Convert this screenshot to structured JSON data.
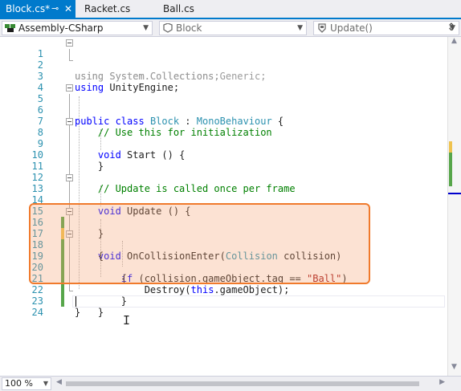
{
  "tabs": [
    {
      "label": "Block.cs*",
      "active": true,
      "pin_icon": "pin-icon",
      "close_icon": "close-icon"
    },
    {
      "label": "Racket.cs",
      "active": false
    },
    {
      "label": "Ball.cs",
      "active": false
    }
  ],
  "navbar": {
    "project": "Assembly-CSharp",
    "type": "Block",
    "member": "Update()"
  },
  "zoom": "100 %",
  "colors": {
    "accent": "#007acc",
    "highlight_border": "#f07a2c",
    "saved_change": "#57a64a",
    "unsaved_change": "#efc34f"
  },
  "lines": [
    {
      "n": "1"
    },
    {
      "n": "2"
    },
    {
      "n": "3"
    },
    {
      "n": "4"
    },
    {
      "n": "5"
    },
    {
      "n": "6"
    },
    {
      "n": "7"
    },
    {
      "n": "8"
    },
    {
      "n": "9"
    },
    {
      "n": "10"
    },
    {
      "n": "11"
    },
    {
      "n": "12"
    },
    {
      "n": "13"
    },
    {
      "n": "14"
    },
    {
      "n": "15"
    },
    {
      "n": "16"
    },
    {
      "n": "17"
    },
    {
      "n": "18"
    },
    {
      "n": "19"
    },
    {
      "n": "20"
    },
    {
      "n": "21"
    },
    {
      "n": "22"
    },
    {
      "n": "23"
    },
    {
      "n": "24"
    }
  ],
  "code": {
    "l1": {
      "kw": "using",
      "rest": " System.Collections;"
    },
    "l2": {
      "kw": "using",
      "rest": " System.Collections.Generic;"
    },
    "l3": {
      "kw": "using",
      "rest": " UnityEngine;"
    },
    "l5": {
      "kw1": "public",
      "kw2": " class",
      "name": " Block",
      "sep": " : ",
      "base": "MonoBehaviour",
      "brace": " {"
    },
    "l7": {
      "comment": "// Use this for initialization"
    },
    "l8": {
      "kw": "void",
      "name": " Start",
      "rest": " () {"
    },
    "l10": {
      "brace": "}"
    },
    "l12": {
      "comment": "// Update is called once per frame"
    },
    "l13": {
      "kw": "void",
      "name": " Update",
      "rest": " () {"
    },
    "l15": {
      "brace": "}"
    },
    "l16": {
      "kw": "void",
      "name": " OnCollisionEnter",
      "p1": "(",
      "ptype": "Collision",
      "pname": " collision)"
    },
    "l17": {
      "brace": "{"
    },
    "l18": {
      "kw": "if",
      "cond": " (collision.gameObject.tag == ",
      "str": "\"Ball\"",
      "end": ")"
    },
    "l19": {
      "brace": "{"
    },
    "l20": {
      "call": "Destroy",
      "p1": "(",
      "kw": "this",
      "rest": ".gameObject);"
    },
    "l21": {
      "brace": "}"
    },
    "l22": {
      "brace": "}"
    },
    "l23": {
      "brace": "}"
    }
  }
}
